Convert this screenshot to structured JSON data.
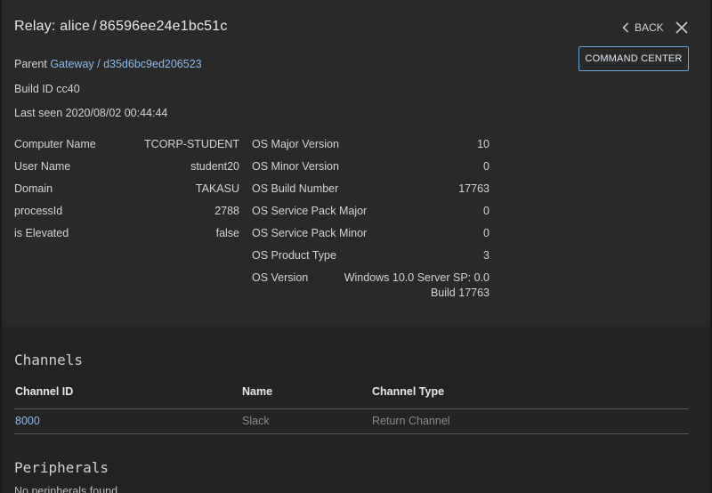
{
  "header": {
    "title_prefix": "Relay:",
    "title_name": "alice",
    "title_sep": "/",
    "title_id": "86596ee24e1bc51c",
    "back_label": "BACK",
    "command_center_label": "COMMAND CENTER"
  },
  "summary": {
    "parent_label": "Parent",
    "parent_link": "Gateway / d35d6bc9ed206523",
    "build_id": "Build ID cc40",
    "last_seen": "Last seen 2020/08/02 00:44:44"
  },
  "left_props": [
    {
      "label": "Computer Name",
      "value": "TCORP-STUDENT"
    },
    {
      "label": "User Name",
      "value": "student20"
    },
    {
      "label": "Domain",
      "value": "TAKASU"
    },
    {
      "label": "processId",
      "value": "2788"
    },
    {
      "label": "is Elevated",
      "value": "false"
    }
  ],
  "right_props": [
    {
      "label": "OS Major Version",
      "value": "10"
    },
    {
      "label": "OS Minor Version",
      "value": "0"
    },
    {
      "label": "OS Build Number",
      "value": "17763"
    },
    {
      "label": "OS Service Pack Major",
      "value": "0"
    },
    {
      "label": "OS Service Pack Minor",
      "value": "0"
    },
    {
      "label": "OS Product Type",
      "value": "3"
    },
    {
      "label": "OS Version",
      "value": "Windows 10.0 Server SP: 0.0",
      "value2": "Build 17763"
    }
  ],
  "channels": {
    "title": "Channels",
    "headers": [
      "Channel ID",
      "Name",
      "Channel Type"
    ],
    "rows": [
      {
        "id": "8000",
        "name": "Slack",
        "type": "Return Channel"
      }
    ]
  },
  "peripherals": {
    "title": "Peripherals",
    "empty_text": "No peripherals found"
  }
}
